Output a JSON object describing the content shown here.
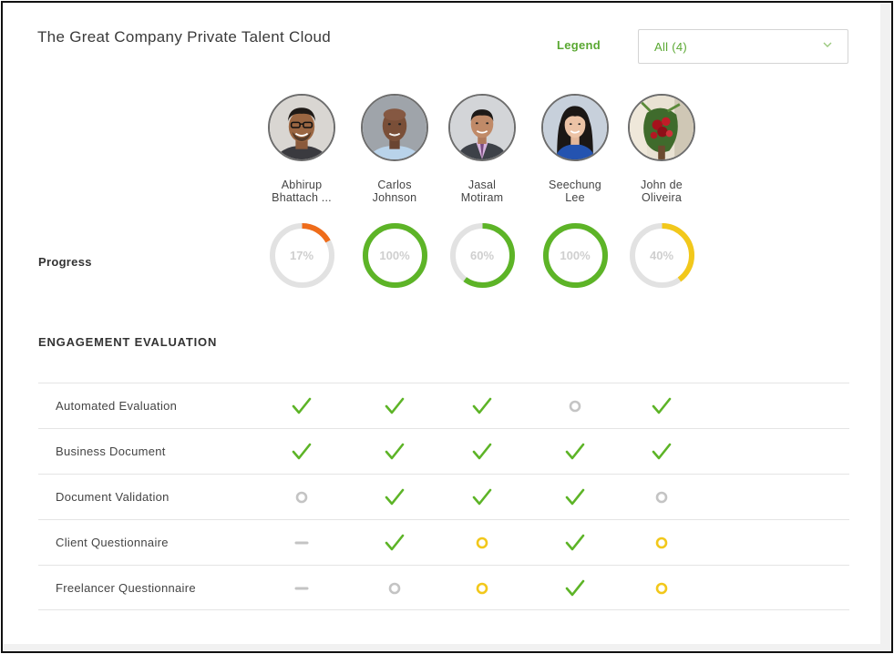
{
  "header": {
    "title": "The Great Company Private Talent Cloud",
    "legend_label": "Legend",
    "legend_value": "All (4)"
  },
  "labels": {
    "progress": "Progress",
    "section_title": "ENGAGEMENT EVALUATION"
  },
  "colors": {
    "green": "#5db427",
    "orange": "#ef6c1a",
    "yellow": "#f2c81b",
    "track": "#e2e2e2",
    "gray_status": "#c4c4c4"
  },
  "people": [
    {
      "name_line1": "Abhirup",
      "name_line2": "Bhattach ...",
      "progress": 17,
      "progress_text": "17%",
      "ring_color": "#ef6c1a",
      "avatar": "avatar-man-glasses"
    },
    {
      "name_line1": "Carlos",
      "name_line2": "Johnson",
      "progress": 100,
      "progress_text": "100%",
      "ring_color": "#5db427",
      "avatar": "avatar-man-bald"
    },
    {
      "name_line1": "Jasal",
      "name_line2": "Motiram",
      "progress": 60,
      "progress_text": "60%",
      "ring_color": "#5db427",
      "avatar": "avatar-man-suit"
    },
    {
      "name_line1": "Seechung",
      "name_line2": "Lee",
      "progress": 100,
      "progress_text": "100%",
      "ring_color": "#5db427",
      "avatar": "avatar-woman"
    },
    {
      "name_line1": "John de",
      "name_line2": "Oliveira",
      "progress": 40,
      "progress_text": "40%",
      "ring_color": "#f2c81b",
      "avatar": "avatar-flowers"
    }
  ],
  "evaluation_rows": [
    {
      "label": "Automated Evaluation",
      "statuses": [
        "check",
        "check",
        "check",
        "pending-gray",
        "check"
      ]
    },
    {
      "label": "Business Document",
      "statuses": [
        "check",
        "check",
        "check",
        "check",
        "check"
      ]
    },
    {
      "label": "Document Validation",
      "statuses": [
        "pending-gray",
        "check",
        "check",
        "check",
        "pending-gray"
      ]
    },
    {
      "label": "Client Questionnaire",
      "statuses": [
        "not-applicable",
        "check",
        "in-progress-yellow",
        "check",
        "in-progress-yellow"
      ]
    },
    {
      "label": "Freelancer Questionnaire",
      "statuses": [
        "not-applicable",
        "pending-gray",
        "in-progress-yellow",
        "check",
        "in-progress-yellow"
      ]
    }
  ]
}
